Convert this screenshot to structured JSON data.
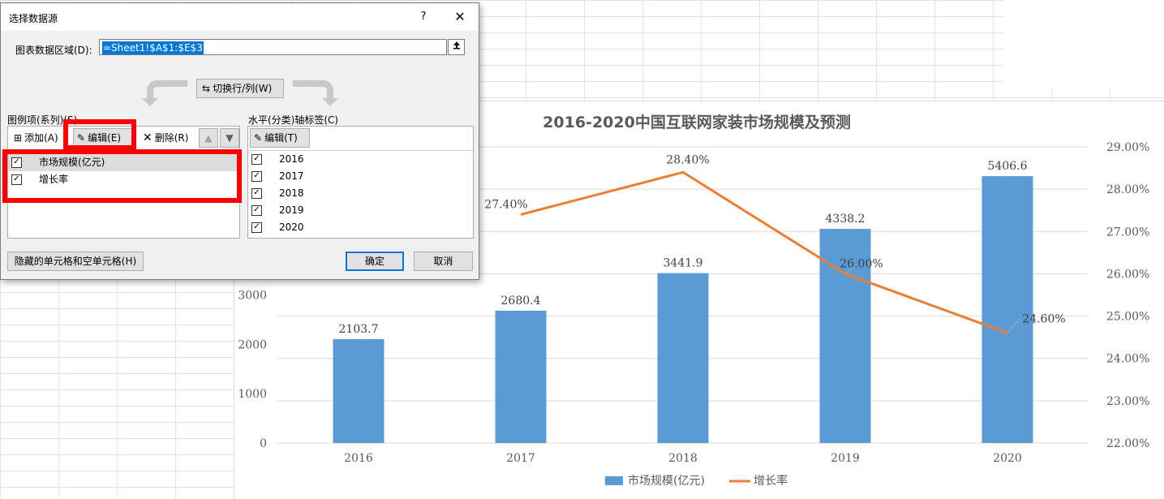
{
  "dialog": {
    "title": "选择数据源",
    "help_glyph": "?",
    "close_glyph": "✕",
    "range_label": "图表数据区域(D):",
    "range_value": "=Sheet1!$A$1:$E$3",
    "switch_label": "切换行/列(W)",
    "series_section_label": "图例项(系列)(S)",
    "category_section_label": "水平(分类)轴标签(C)",
    "series_toolbar": {
      "add": "添加(A)",
      "edit": "编辑(E)",
      "delete": "删除(R)"
    },
    "category_toolbar": {
      "edit": "编辑(T)"
    },
    "series": [
      {
        "label": "市场规模(亿元)",
        "checked": true
      },
      {
        "label": "增长率",
        "checked": true
      }
    ],
    "categories": [
      {
        "label": "2016",
        "checked": true
      },
      {
        "label": "2017",
        "checked": true
      },
      {
        "label": "2018",
        "checked": true
      },
      {
        "label": "2019",
        "checked": true
      },
      {
        "label": "2020",
        "checked": true
      }
    ],
    "hidden_cells_button": "隐藏的单元格和空单元格(H)",
    "ok_button": "确定",
    "cancel_button": "取消"
  },
  "chart_data": {
    "type": "bar",
    "title": "2016-2020中国互联网家装市场规模及预测",
    "categories": [
      "2016",
      "2017",
      "2018",
      "2019",
      "2020"
    ],
    "series": [
      {
        "name": "市场规模(亿元)",
        "type": "bar",
        "axis": "left",
        "color": "#5b9bd5",
        "values": [
          2103.7,
          2680.4,
          3441.9,
          4338.2,
          5406.6
        ],
        "labels": [
          "2103.7",
          "2680.4",
          "3441.9",
          "4338.2",
          "5406.6"
        ]
      },
      {
        "name": "增长率",
        "type": "line",
        "axis": "right",
        "color": "#ed7d31",
        "values": [
          null,
          27.4,
          28.4,
          26.0,
          24.6
        ],
        "labels": [
          "",
          "27.40%",
          "28.40%",
          "26.00%",
          "24.60%"
        ]
      }
    ],
    "y_left": {
      "min": 0,
      "max": 6000,
      "visible_ticks": [
        "0",
        "1000",
        "2000",
        "3000"
      ],
      "tick_values": [
        0,
        1000,
        2000,
        3000
      ]
    },
    "y_right": {
      "min": 22,
      "max": 29,
      "tick_labels": [
        "22.00%",
        "23.00%",
        "24.00%",
        "25.00%",
        "26.00%",
        "27.00%",
        "28.00%",
        "29.00%"
      ],
      "tick_values": [
        22,
        23,
        24,
        25,
        26,
        27,
        28,
        29
      ]
    },
    "gridlines": true,
    "legend_position": "bottom"
  },
  "annotations": {
    "highlight_color": "#ff0000"
  }
}
